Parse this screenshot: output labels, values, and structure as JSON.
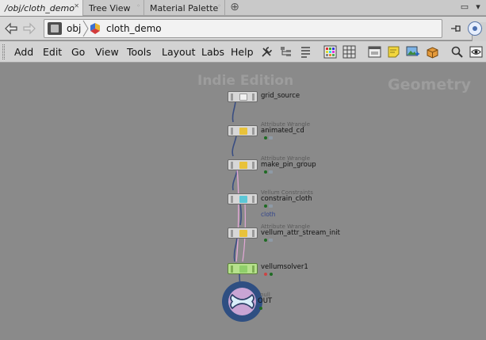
{
  "tabs": [
    {
      "label": "/obj/cloth_demo",
      "active": true
    },
    {
      "label": "Tree View",
      "active": false
    },
    {
      "label": "Material Palette",
      "active": false
    }
  ],
  "path": {
    "root": "obj",
    "current": "cloth_demo"
  },
  "menu": [
    "Add",
    "Edit",
    "Go",
    "View",
    "Tools",
    "Layout",
    "Labs",
    "Help"
  ],
  "toolbar_icons": [
    "wrench-icon",
    "tree-icon",
    "list-icon",
    "grid-color-icon",
    "grid-icon",
    "network-box-icon",
    "sticky-note-icon",
    "image-icon",
    "package-icon",
    "search-icon",
    "eye-icon"
  ],
  "canvas": {
    "watermark_edition": "Indie Edition",
    "watermark_context": "Geometry"
  },
  "nodes": [
    {
      "type": "",
      "name": "grid_source",
      "icon": "grid-icon"
    },
    {
      "type": "Attribute Wrangle",
      "name": "animated_cd",
      "icon": "wrangle-icon"
    },
    {
      "type": "Attribute Wrangle",
      "name": "make_pin_group",
      "icon": "wrangle-icon"
    },
    {
      "type": "Vellum Constraints",
      "name": "constrain_cloth",
      "icon": "vellum-constraint-icon"
    },
    {
      "type": "Attribute Wrangle",
      "name": "vellum_attr_stream_init",
      "icon": "wrangle-icon"
    },
    {
      "type": "",
      "name": "vellumsolver1",
      "icon": "vellum-solver-icon"
    },
    {
      "type": "null",
      "name": "OUT",
      "icon": "null-icon"
    }
  ],
  "wire_label": "cloth",
  "colors": {
    "canvas_bg": "#8a8a8a",
    "node_bg": "#d7d7d7",
    "solver_bg": "#b6e18c",
    "null_ring": "#2f4f82",
    "wire": "#3a4e82",
    "pink_wire": "#e2a8d6",
    "display_flag": "#1e6b23"
  }
}
